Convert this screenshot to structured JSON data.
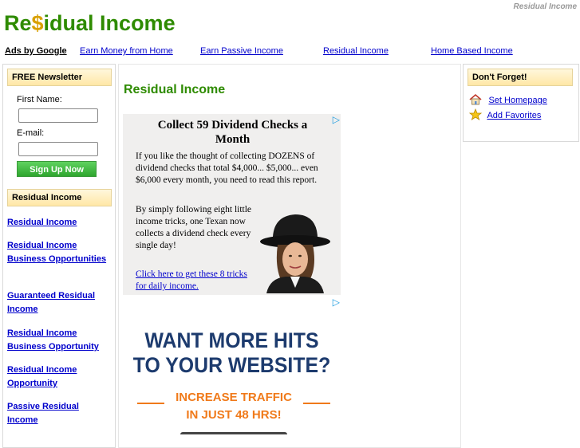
{
  "header": {
    "top_tag": "Residual Income",
    "logo_prefix": "Re",
    "logo_dollar": "$",
    "logo_suffix": "idual Income"
  },
  "ads_bar": {
    "label": "Ads by Google",
    "links": [
      "Earn Money from Home",
      "Earn Passive Income",
      "Residual Income",
      "Home Based Income"
    ]
  },
  "newsletter": {
    "title": "FREE Newsletter",
    "first_name_label": "First Name:",
    "first_name_value": "",
    "email_label": "E-mail:",
    "email_value": "",
    "signup_label": "Sign Up Now"
  },
  "left_section": {
    "title": "Residual Income",
    "links": [
      "Residual Income",
      "Residual Income Business Opportunities",
      "Guaranteed Residual Income",
      "Residual Income Business Opportunity",
      "Residual Income Opportunity",
      "Passive Residual Income"
    ]
  },
  "main": {
    "title": "Residual Income"
  },
  "ad1": {
    "headline": "Collect 59 Dividend Checks a Month",
    "para1": "If you like the thought of collecting DOZENS of dividend checks that total $4,000... $5,000... even $6,000 every month, you need to read this report.",
    "para2": "By simply following eight little income tricks, one Texan now collects a dividend check every single day!",
    "link": "Click here to get these 8 tricks for daily income."
  },
  "ad2": {
    "headline1": "WANT MORE HITS",
    "headline2": "TO YOUR WEBSITE?",
    "sub1": "INCREASE TRAFFIC",
    "sub2": "IN JUST 48 HRS!"
  },
  "right_box": {
    "title": "Don't Forget!",
    "links": [
      "Set Homepage",
      "Add Favorites"
    ]
  },
  "icons": {
    "ad_choice": "ad-choices-icon",
    "home": "home-icon",
    "star": "star-icon"
  },
  "colors": {
    "brand_green": "#2e8b00",
    "link_blue": "#0000cc",
    "accent_orange": "#f07a1a",
    "ad_navy": "#1d3b6e"
  }
}
